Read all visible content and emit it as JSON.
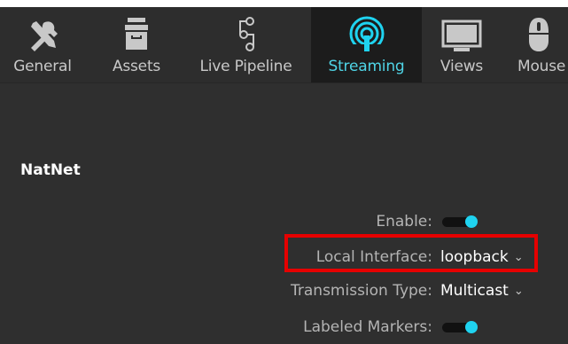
{
  "toolbar": {
    "tabs": [
      {
        "label": "General",
        "icon": "tools-icon",
        "active": false
      },
      {
        "label": "Assets",
        "icon": "assets-box-icon",
        "active": false
      },
      {
        "label": "Live Pipeline",
        "icon": "pipeline-icon",
        "active": false
      },
      {
        "label": "Streaming",
        "icon": "streaming-icon",
        "active": true
      },
      {
        "label": "Views",
        "icon": "monitor-icon",
        "active": false
      },
      {
        "label": "Mouse",
        "icon": "mouse-icon",
        "active": false
      }
    ]
  },
  "section": {
    "title": "NatNet"
  },
  "settings": {
    "enable": {
      "label": "Enable:",
      "value": true
    },
    "local_interface": {
      "label": "Local Interface:",
      "value": "loopback"
    },
    "transmission_type": {
      "label": "Transmission Type:",
      "value": "Multicast"
    },
    "labeled_markers": {
      "label": "Labeled Markers:",
      "value": true
    }
  },
  "colors": {
    "accent": "#1fd3f0",
    "active_tab_text": "#4fd4e6",
    "highlight": "#e60000",
    "panel_bg": "#2f2f2f"
  }
}
